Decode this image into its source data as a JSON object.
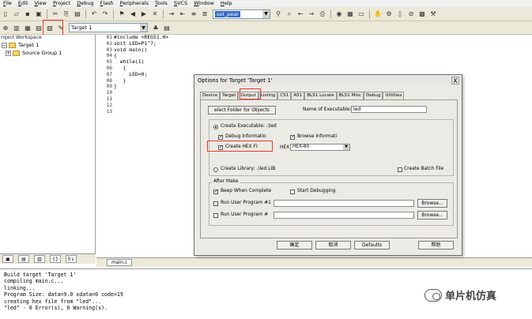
{
  "menu": [
    "File",
    "Edit",
    "View",
    "Project",
    "Debug",
    "Flash",
    "Peripherals",
    "Tools",
    "SVCS",
    "Window",
    "Help"
  ],
  "toolbar": {
    "find_text": "set_pear",
    "target": "Target 1"
  },
  "workspace": {
    "title": "roject Workspace",
    "target": "Target 1",
    "group": "Source Group 1"
  },
  "editor": {
    "line_numbers": [
      "01",
      "02",
      "03",
      "04",
      "05",
      "06",
      "07",
      "08",
      "09",
      "10",
      "11",
      "12",
      "13"
    ],
    "code": [
      "#include <REG51.H>",
      "sbit LED=P1^7;",
      "void main()",
      "{",
      "  while(1)",
      "   {",
      "     LED=0;",
      "   }",
      "}",
      "",
      "",
      "",
      ""
    ],
    "tab": "main.c"
  },
  "dialog": {
    "title": "Options for Target 'Target 1'",
    "close": "X",
    "tabs": [
      "Device",
      "Target",
      "Output",
      "Listing",
      "C51",
      "A51",
      "BL51 Locate",
      "BL51 Misc",
      "Debug",
      "Utilities"
    ],
    "active_tab": "Output",
    "select_folder": "elect Folder for Objects",
    "name_label": "Name of Executable:",
    "name_value": "led",
    "create_exe": "Create Executable:  .\\led",
    "debug_info": "Debug Informatio",
    "browse_info": "Browse Informati",
    "create_hex": "Create HEX Fi:",
    "hex_label": "HEX",
    "hex_format": "HEX-80",
    "create_lib": "Create Library:  .\\led.LIB",
    "batch_file": "Create Batch File",
    "after_make": "After Make",
    "beep": "Beep When Complete",
    "start_debug": "Start Debugging",
    "run1": "Run User Program #1",
    "run2": "Run User Program #",
    "browse": "Browse...",
    "ok": "确定",
    "cancel": "取消",
    "defaults": "Defaults",
    "help": "帮助"
  },
  "output": [
    "Build target 'Target 1'",
    "compiling main.c...",
    "linking...",
    "Program Size: data=9.0 xdata=0 code=19",
    "creating hex file from \"led\"...",
    "\"led\" - 0 Error(s), 0 Warning(s)."
  ],
  "watermark": "单片机仿真",
  "colors": {
    "highlight": "#e33333",
    "selection": "#316ac5"
  }
}
